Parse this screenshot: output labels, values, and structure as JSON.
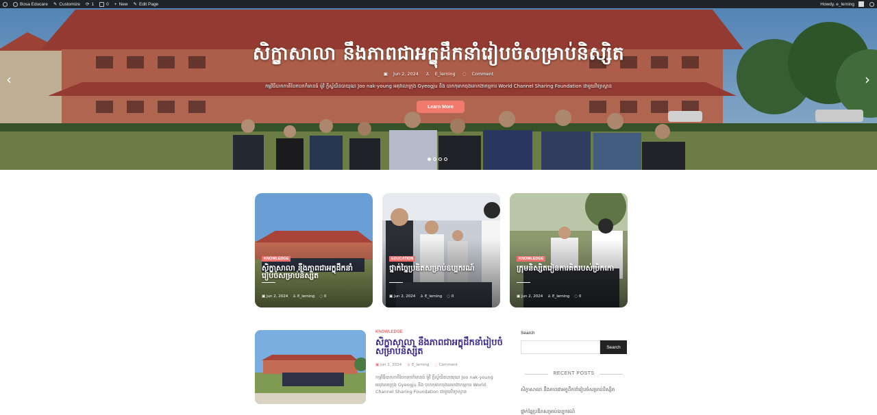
{
  "adminbar": {
    "site_name": "Bosa Educare",
    "customize": "Customize",
    "updates_count": "1",
    "comments_count": "0",
    "new_label": "New",
    "edit_page": "Edit Page",
    "howdy": "Howdy, e_lerning"
  },
  "hero": {
    "title": "សិក្ខាសាលា នឹងភាពជាអក្ខុដឹកនាំរៀបចំសម្រាប់និស្សិត",
    "date": "Jun 2, 2024",
    "author": "E_lerning",
    "comments": "Comment",
    "excerpt": "កម្មវិធីបាកកាតីបែកបកក៏មានធំ ម៉ូវិ ក្លីស្វ័យិនបាយុណ Joo nak-young អគុវាលាក្រុង Gyeogju និង បាកកុមាកចុងតោកងាកម្មការ World Channel Sharing Foundation ជាមួយវិទ្យាស្ថាន",
    "button_label": "Learn More",
    "slide_count": 4,
    "active_slide": 1
  },
  "cards": [
    {
      "badge": "KNOWLEDGE",
      "title": "សិក្ខាសាលា នឹងភាពជាអក្ខុដឹកនាំរៀបចំសម្រាប់និស្សិត",
      "date": "Jun 2, 2024",
      "author": "E_lerning",
      "comments": "0"
    },
    {
      "badge": "EDUCATION",
      "title": "ថ្នាក់ច្នៃប្រឌិតសម្រាប់ឧប្បករណ៍",
      "date": "Jun 2, 2024",
      "author": "E_lerning",
      "comments": "0"
    },
    {
      "badge": "KNOWLEDGE",
      "title": "ក្រុមនិស្សិតរៀនការគិតរបស់ប្រិកកោ",
      "date": "Jun 2, 2024",
      "author": "E_lerning",
      "comments": "0"
    }
  ],
  "post": {
    "category": "KNOWLEDGE",
    "title": "សិក្ខាសាលា នឹងភាពជាអក្ខុដឹកនាំរៀបចំសម្រាប់និស្សិត",
    "date": "Jun 2, 2024",
    "author": "E_lerning",
    "comments": "Comment",
    "excerpt": "កម្មវិធីបាកកាតីបែកបកក៏មានធំ ម៉ូវិ ក្លីស្វ័យិនបាយុណ Joo nak-young អគុវាលាក្រុង Gyeogju និង បាកកុមាកចុងតោកងាកម្មការ World Channel Sharing Foundation ជាមួយវិទ្យាស្ថាន"
  },
  "sidebar": {
    "search_label": "Search",
    "search_button": "Search",
    "recent_heading": "RECENT POSTS",
    "recent_posts": [
      "សិក្ខាសាលា នឹងភាពជាអក្ខុដឹកនាំរៀបចំសម្រាប់និស្សិត",
      "ថ្នាក់ច្នៃប្រឌិតសម្រាប់ឧប្បករណ៍"
    ]
  },
  "colors": {
    "accent": "#ef6f6c",
    "title": "#3b2a8c",
    "adminbar": "#1d2327"
  }
}
